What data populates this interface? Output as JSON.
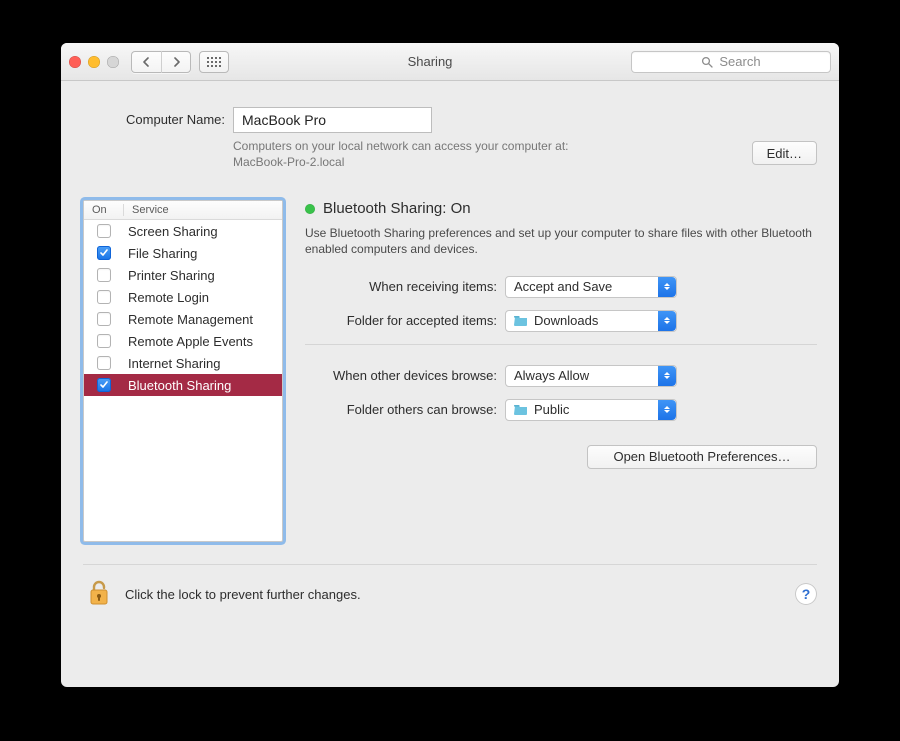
{
  "window_title": "Sharing",
  "search_placeholder": "Search",
  "computer_name_label": "Computer Name:",
  "computer_name_value": "MacBook Pro",
  "computer_name_desc_line1": "Computers on your local network can access your computer at:",
  "computer_name_desc_line2": "MacBook-Pro-2.local",
  "edit_button": "Edit…",
  "service_head_on": "On",
  "service_head_service": "Service",
  "services": [
    {
      "label": "Screen Sharing",
      "checked": false,
      "selected": false
    },
    {
      "label": "File Sharing",
      "checked": true,
      "selected": false
    },
    {
      "label": "Printer Sharing",
      "checked": false,
      "selected": false
    },
    {
      "label": "Remote Login",
      "checked": false,
      "selected": false
    },
    {
      "label": "Remote Management",
      "checked": false,
      "selected": false
    },
    {
      "label": "Remote Apple Events",
      "checked": false,
      "selected": false
    },
    {
      "label": "Internet Sharing",
      "checked": false,
      "selected": false
    },
    {
      "label": "Bluetooth Sharing",
      "checked": true,
      "selected": true
    }
  ],
  "status_title": "Bluetooth Sharing: On",
  "status_color": "#39c24a",
  "status_desc": "Use Bluetooth Sharing preferences and set up your computer to share files with other Bluetooth enabled computers and devices.",
  "form": {
    "receiving_label": "When receiving items:",
    "receiving_value": "Accept and Save",
    "accepted_folder_label": "Folder for accepted items:",
    "accepted_folder_value": "Downloads",
    "browse_label": "When other devices browse:",
    "browse_value": "Always Allow",
    "browse_folder_label": "Folder others can browse:",
    "browse_folder_value": "Public"
  },
  "open_bt_prefs": "Open Bluetooth Preferences…",
  "lock_text": "Click the lock to prevent further changes.",
  "help_label": "?"
}
